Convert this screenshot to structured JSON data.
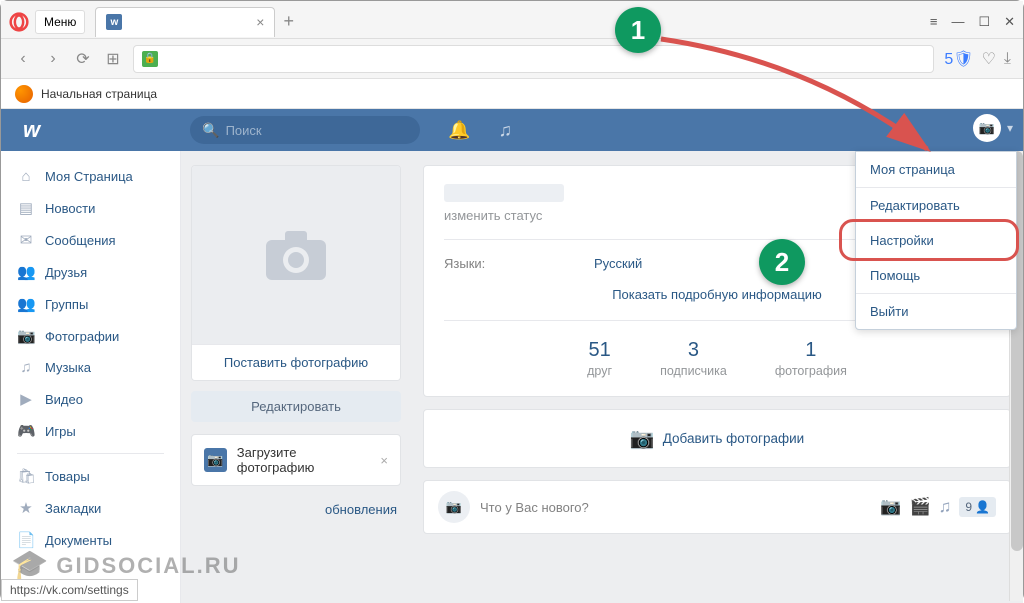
{
  "browser": {
    "menu_label": "Меню",
    "tab_title": "",
    "bookmark": "Начальная страница",
    "url_display": "",
    "badge_num": "5",
    "status_url": "https://vk.com/settings"
  },
  "vk_header": {
    "search_placeholder": "Поиск"
  },
  "sidebar": {
    "items": [
      {
        "icon": "⌂",
        "label": "Моя Страница"
      },
      {
        "icon": "▤",
        "label": "Новости"
      },
      {
        "icon": "✉",
        "label": "Сообщения"
      },
      {
        "icon": "👥",
        "label": "Друзья"
      },
      {
        "icon": "👥",
        "label": "Группы"
      },
      {
        "icon": "📷",
        "label": "Фотографии"
      },
      {
        "icon": "♫",
        "label": "Музыка"
      },
      {
        "icon": "▶",
        "label": "Видео"
      },
      {
        "icon": "🎮",
        "label": "Игры"
      }
    ],
    "items2": [
      {
        "icon": "🛍",
        "label": "Товары"
      },
      {
        "icon": "★",
        "label": "Закладки"
      },
      {
        "icon": "📄",
        "label": "Документы"
      }
    ]
  },
  "middle": {
    "upload_photo_link": "Поставить фотографию",
    "edit_btn": "Редактировать",
    "upload_box": "Загрузите фотографию",
    "updates": "обновления"
  },
  "profile": {
    "status": "изменить статус",
    "lang_label": "Языки:",
    "lang_value": "Русский",
    "show_more": "Показать подробную информацию",
    "stats": [
      {
        "num": "51",
        "label": "друг"
      },
      {
        "num": "3",
        "label": "подписчика"
      },
      {
        "num": "1",
        "label": "фотография"
      }
    ],
    "add_photos": "Добавить фотографии",
    "post_placeholder": "Что у Вас нового?",
    "post_badge": "9"
  },
  "dropdown": {
    "items": [
      "Моя страница",
      "Редактировать",
      "Настройки",
      "Помощь"
    ],
    "logout": "Выйти"
  },
  "markers": {
    "one": "1",
    "two": "2"
  },
  "watermark": "GIDSOCIAL.RU"
}
